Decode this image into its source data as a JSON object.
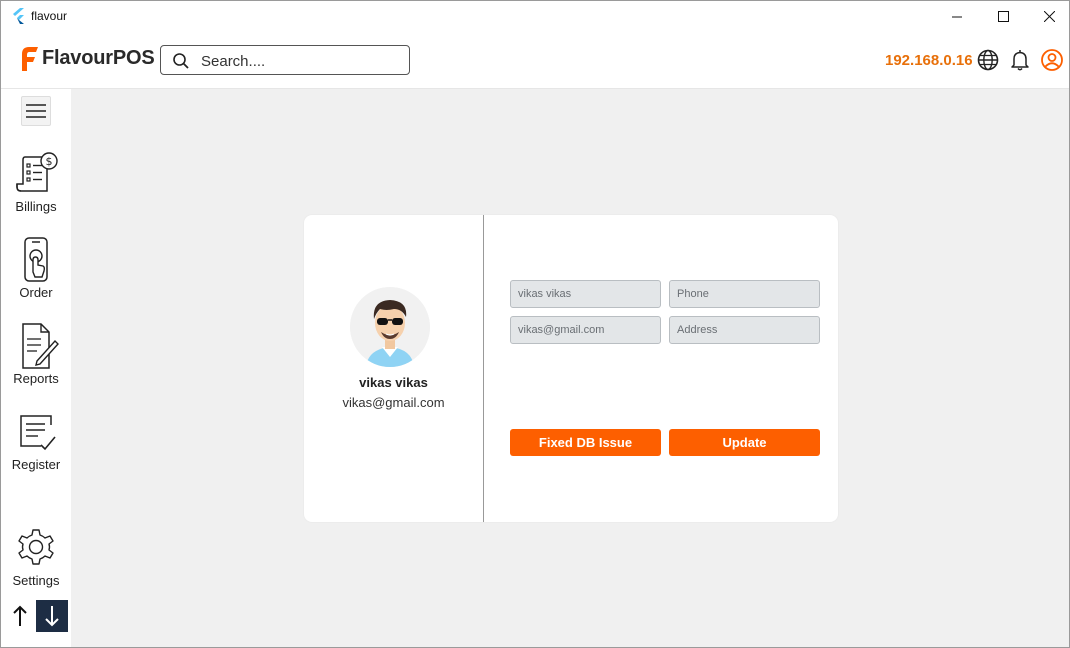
{
  "window": {
    "title": "flavour"
  },
  "header": {
    "logo_text": "FlavourPOS",
    "search_placeholder": "Search....",
    "ip": "192.168.0.16"
  },
  "sidebar": {
    "items": [
      {
        "label": "Billings",
        "icon": "billing-icon"
      },
      {
        "label": "Order",
        "icon": "phone-order-icon"
      },
      {
        "label": "Reports",
        "icon": "report-icon"
      },
      {
        "label": "Register",
        "icon": "register-icon"
      },
      {
        "label": "Settings",
        "icon": "gear-icon"
      }
    ]
  },
  "profile": {
    "name": "vikas vikas",
    "email": "vikas@gmail.com"
  },
  "form": {
    "name_value": "vikas vikas",
    "phone_placeholder": "Phone",
    "email_value": "vikas@gmail.com",
    "address_placeholder": "Address",
    "fix_db_label": "Fixed DB Issue",
    "update_label": "Update"
  },
  "colors": {
    "accent": "#fd5f00",
    "ip_color": "#e8700a",
    "dark_nav": "#1d2d44"
  }
}
